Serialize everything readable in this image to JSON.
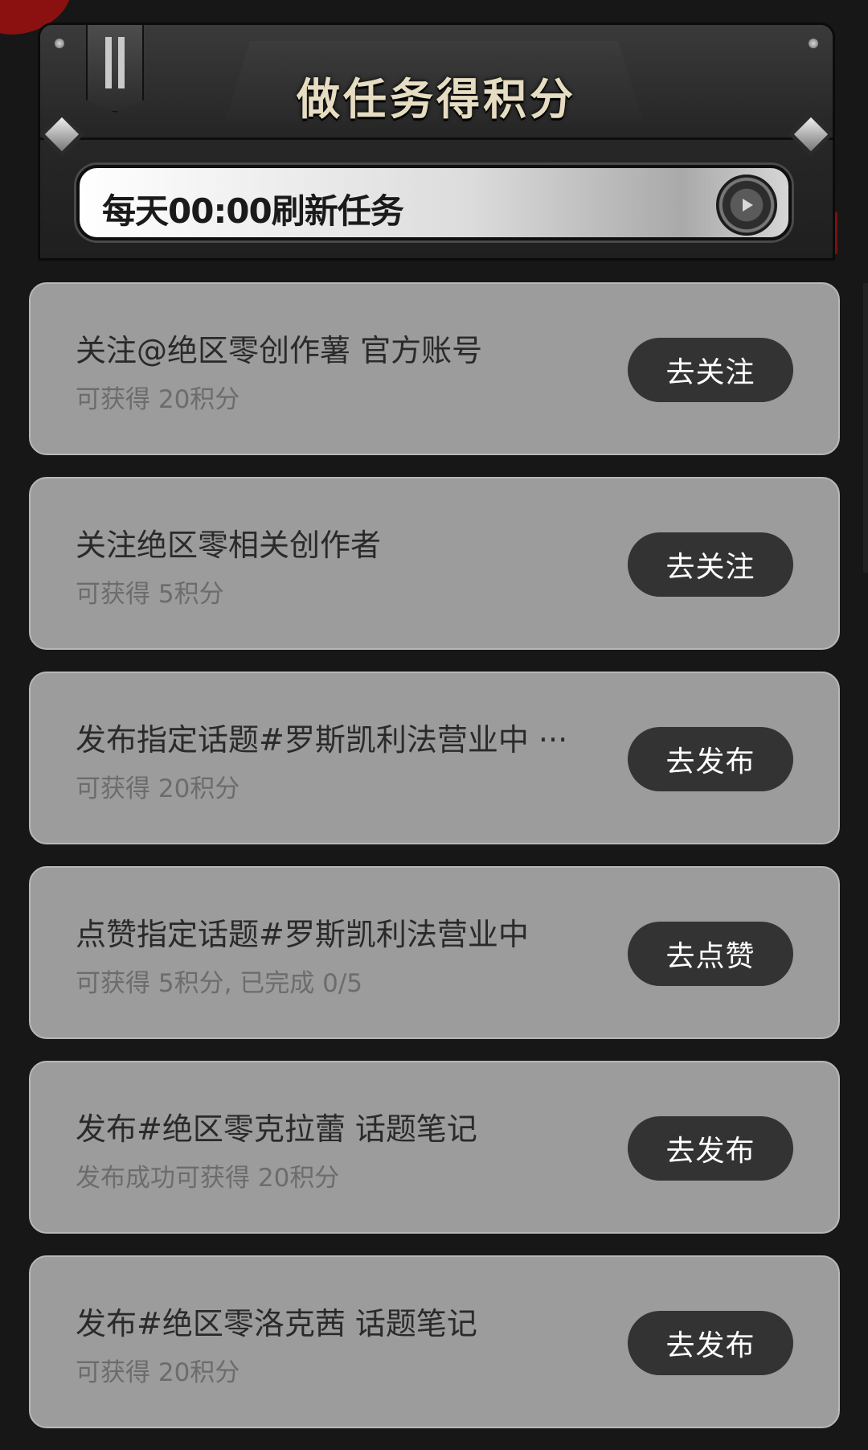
{
  "header": {
    "title": "做任务得积分",
    "refresh_notice": "每天00:00刷新任务",
    "roman_badge": "II"
  },
  "colors": {
    "background": "#171717",
    "card": "#9c9c9c",
    "button": "#333333",
    "title_text": "#e6dcc1",
    "accent_red": "#8b1111"
  },
  "tasks": [
    {
      "title": "关注@绝区零创作薯 官方账号",
      "reward": "可获得 20积分",
      "button": "去关注"
    },
    {
      "title": "关注绝区零相关创作者",
      "reward": "可获得 5积分",
      "button": "去关注"
    },
    {
      "title": "发布指定话题#罗斯凯利法营业中 ···",
      "reward": "可获得 20积分",
      "button": "去发布"
    },
    {
      "title": "点赞指定话题#罗斯凯利法营业中",
      "reward": "可获得 5积分, 已完成 0/5",
      "button": "去点赞"
    },
    {
      "title": "发布#绝区零克拉蕾 话题笔记",
      "reward": "发布成功可获得 20积分",
      "button": "去发布"
    },
    {
      "title": "发布#绝区零洛克茜 话题笔记",
      "reward": "可获得 20积分",
      "button": "去发布"
    }
  ]
}
